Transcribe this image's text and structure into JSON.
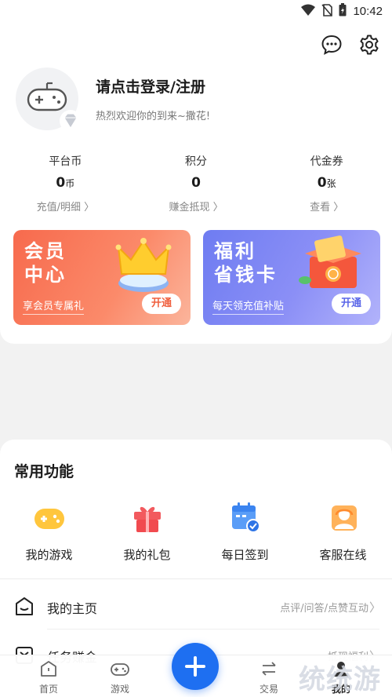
{
  "status_bar": {
    "time": "10:42"
  },
  "profile": {
    "login_title": "请点击登录/注册",
    "welcome_text": "热烈欢迎你的到来~撒花!"
  },
  "stats": [
    {
      "label": "平台币",
      "value": "0",
      "unit": "币",
      "link": "充值/明细 〉"
    },
    {
      "label": "积分",
      "value": "0",
      "unit": "",
      "link": "赚金抵现 〉"
    },
    {
      "label": "代金券",
      "value": "0",
      "unit": "张",
      "link": "查看 〉"
    }
  ],
  "promos": {
    "vip": {
      "title": "会员\n中心",
      "subtitle": "享会员专属礼",
      "button": "开通",
      "color": "#f76a4d"
    },
    "card": {
      "title": "福利\n省钱卡",
      "subtitle": "每天领充值补贴",
      "button": "开通",
      "color": "#6e7cf1"
    }
  },
  "functions": {
    "title": "常用功能",
    "items": [
      {
        "label": "我的游戏",
        "icon": "gamepad-icon"
      },
      {
        "label": "我的礼包",
        "icon": "gift-icon"
      },
      {
        "label": "每日签到",
        "icon": "calendar-check-icon"
      },
      {
        "label": "客服在线",
        "icon": "customer-service-icon"
      }
    ]
  },
  "menu": [
    {
      "label": "我的主页",
      "right": "点评/问答/点赞互动",
      "icon": "home-face-icon"
    },
    {
      "label": "任务赚金",
      "right": "抵现福利",
      "icon": "task-icon"
    }
  ],
  "tabbar": {
    "items": [
      {
        "label": "首页",
        "icon": "home-icon"
      },
      {
        "label": "游戏",
        "icon": "gamepad-icon"
      },
      {
        "label": "交易",
        "icon": "trade-icon"
      },
      {
        "label": "我的",
        "icon": "user-icon"
      }
    ]
  },
  "watermark": "统统游"
}
